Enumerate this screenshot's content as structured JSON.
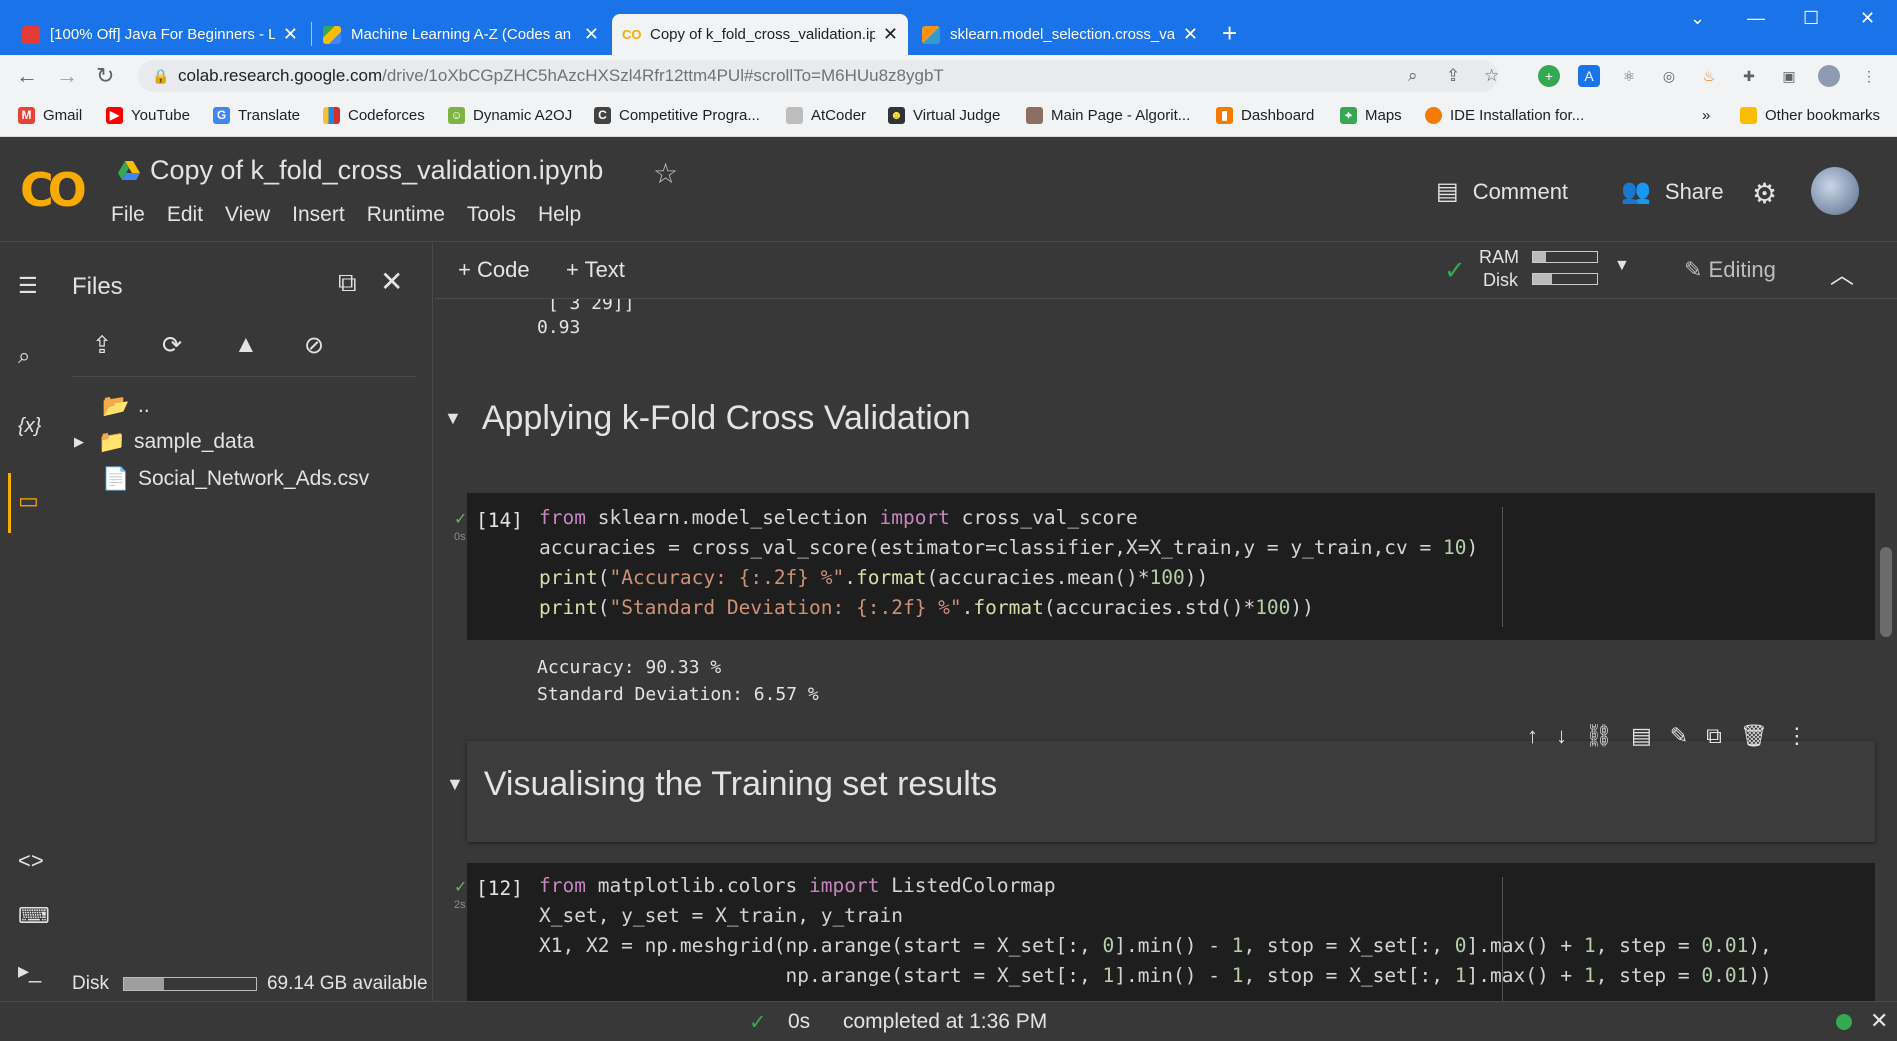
{
  "browser": {
    "tabs": [
      {
        "title": "[100% Off] Java For Beginners - L",
        "active": false
      },
      {
        "title": "Machine Learning A-Z (Codes an",
        "active": false
      },
      {
        "title": "Copy of k_fold_cross_validation.ip",
        "active": true
      },
      {
        "title": "sklearn.model_selection.cross_val",
        "active": false
      }
    ],
    "url_host": "colab.research.google.com",
    "url_path": "/drive/1oXbCGpZHC5hAzcHXSzl4Rfr12ttm4PUl#scrollTo=M6HUu8z8ygbT",
    "bookmarks": [
      "Gmail",
      "YouTube",
      "Translate",
      "Codeforces",
      "Dynamic A2OJ",
      "Competitive Progra...",
      "AtCoder",
      "Virtual Judge",
      "Main Page - Algorit...",
      "Dashboard",
      "Maps",
      "IDE Installation for..."
    ],
    "more_bookmarks": "»",
    "other_bookmarks": "Other bookmarks"
  },
  "colab": {
    "logo": "CO",
    "notebook_title": "Copy of k_fold_cross_validation.ipynb",
    "menu": [
      "File",
      "Edit",
      "View",
      "Insert",
      "Runtime",
      "Tools",
      "Help"
    ],
    "comment_label": "Comment",
    "share_label": "Share",
    "add_code_label": "+ Code",
    "add_text_label": "+ Text",
    "ram_label": "RAM",
    "disk_label": "Disk",
    "ram_fraction": 0.2,
    "disk_fraction": 0.3,
    "editing_label": "Editing"
  },
  "files_panel": {
    "title": "Files",
    "items": [
      {
        "name": "..",
        "type": "parent"
      },
      {
        "name": "sample_data",
        "type": "folder"
      },
      {
        "name": "Social_Network_Ads.csv",
        "type": "file"
      }
    ],
    "disk_label": "Disk",
    "disk_available": "69.14 GB available",
    "disk_used_fraction": 0.3
  },
  "notebook": {
    "prev_output_line1": " [ 3 29]]",
    "prev_output_line2": "0.93",
    "section1_title": "Applying k-Fold Cross Validation",
    "cell14_label": "[14]",
    "cell14_runtime": "0s",
    "cell14_output_line1": "Accuracy: 90.33 %",
    "cell14_output_line2": "Standard Deviation: 6.57 %",
    "section2_title": "Visualising the Training set results",
    "cell12_label": "[12]",
    "cell12_runtime": "2s"
  },
  "status": {
    "time": "0s",
    "completed": "completed at 1:36 PM"
  },
  "colors": {
    "accent": "#f9ab00",
    "ok": "#34a853",
    "chrome_blue": "#1a73e8"
  }
}
